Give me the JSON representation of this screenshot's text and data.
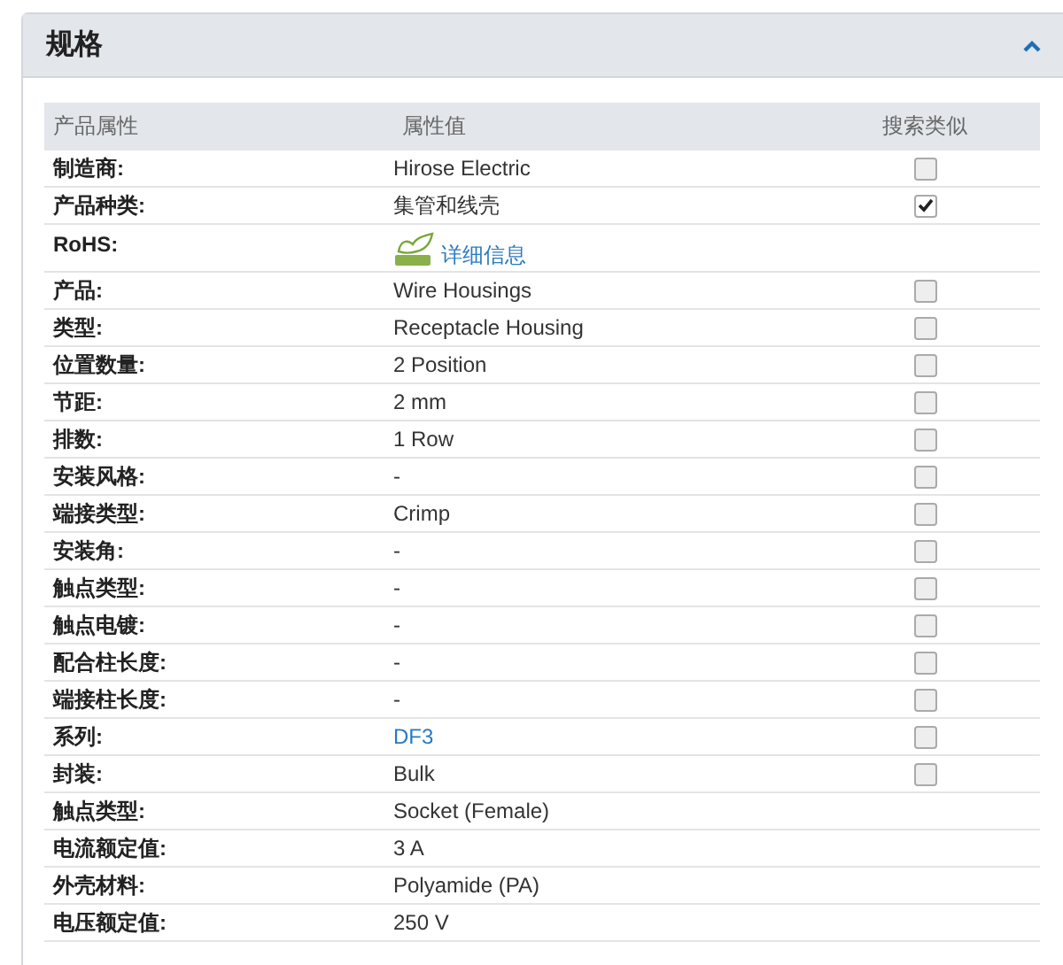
{
  "panel": {
    "title": "规格",
    "expanded": true
  },
  "table": {
    "columns": [
      "产品属性",
      "属性值",
      "搜索类似"
    ],
    "rows": [
      {
        "label": "制造商:",
        "value": "Hirose Electric",
        "kind": "text",
        "checked": false
      },
      {
        "label": "产品种类:",
        "value": "集管和线壳",
        "kind": "text",
        "checked": true
      },
      {
        "label": "RoHS:",
        "value": "详细信息",
        "kind": "rohs"
      },
      {
        "label": "产品:",
        "value": "Wire Housings",
        "kind": "text",
        "checked": false
      },
      {
        "label": "类型:",
        "value": "Receptacle Housing",
        "kind": "text",
        "checked": false
      },
      {
        "label": "位置数量:",
        "value": "2 Position",
        "kind": "text",
        "checked": false
      },
      {
        "label": "节距:",
        "value": "2 mm",
        "kind": "text",
        "checked": false
      },
      {
        "label": "排数:",
        "value": "1 Row",
        "kind": "text",
        "checked": false
      },
      {
        "label": "安装风格:",
        "value": "-",
        "kind": "text",
        "checked": false
      },
      {
        "label": "端接类型:",
        "value": "Crimp",
        "kind": "text",
        "checked": false
      },
      {
        "label": "安装角:",
        "value": "-",
        "kind": "text",
        "checked": false
      },
      {
        "label": "触点类型:",
        "value": "-",
        "kind": "text",
        "checked": false
      },
      {
        "label": "触点电镀:",
        "value": "-",
        "kind": "text",
        "checked": false
      },
      {
        "label": "配合柱长度:",
        "value": "-",
        "kind": "text",
        "checked": false
      },
      {
        "label": "端接柱长度:",
        "value": "-",
        "kind": "text",
        "checked": false
      },
      {
        "label": "系列:",
        "value": "DF3",
        "kind": "link",
        "checked": false
      },
      {
        "label": "封装:",
        "value": "Bulk",
        "kind": "text",
        "checked": false
      },
      {
        "label": "触点类型:",
        "value": "Socket (Female)",
        "kind": "text"
      },
      {
        "label": "电流额定值:",
        "value": "3 A",
        "kind": "text"
      },
      {
        "label": "外壳材料:",
        "value": "Polyamide (PA)",
        "kind": "text"
      },
      {
        "label": "电压额定值:",
        "value": "250 V",
        "kind": "text"
      }
    ]
  }
}
